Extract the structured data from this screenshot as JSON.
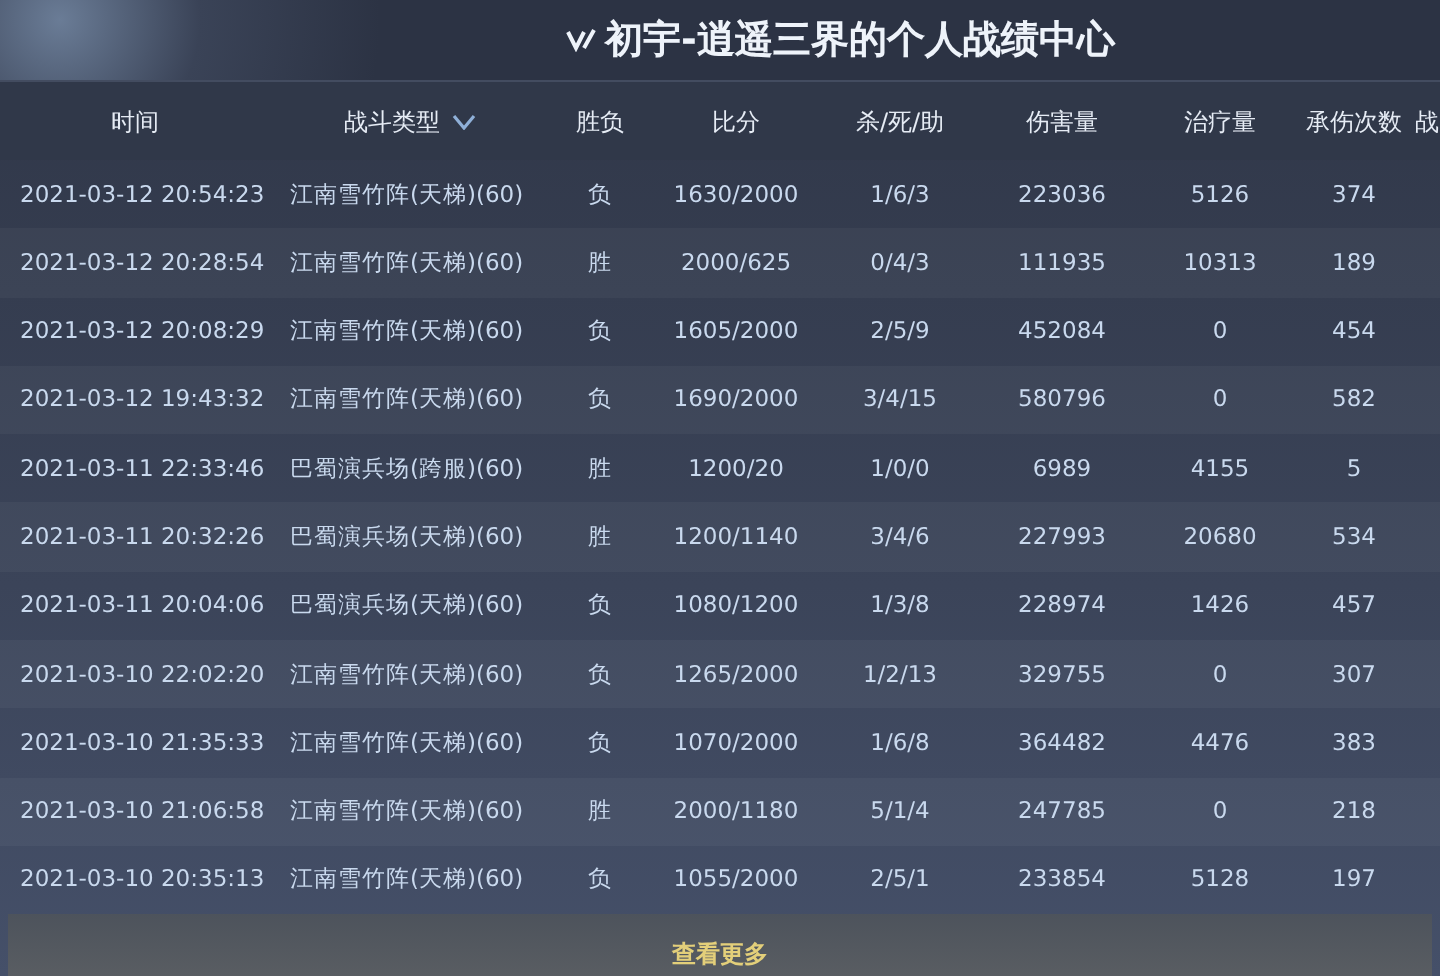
{
  "title": "初宇-逍遥三界的个人战绩中心",
  "table": {
    "columns": [
      {
        "label": "时间"
      },
      {
        "label": "战斗类型",
        "has_filter": true
      },
      {
        "label": "胜负"
      },
      {
        "label": "比分"
      },
      {
        "label": "杀/死/助"
      },
      {
        "label": "伤害量"
      },
      {
        "label": "治疗量"
      },
      {
        "label": "承伤次数"
      },
      {
        "label": "战"
      }
    ],
    "rows": [
      {
        "time": "2021-03-12 20:54:23",
        "type": "江南雪竹阵(天梯)(60)",
        "result": "负",
        "score": "1630/2000",
        "kda": "1/6/3",
        "damage": "223036",
        "healing": "5126",
        "hits_taken": "374"
      },
      {
        "time": "2021-03-12 20:28:54",
        "type": "江南雪竹阵(天梯)(60)",
        "result": "胜",
        "score": "2000/625",
        "kda": "0/4/3",
        "damage": "111935",
        "healing": "10313",
        "hits_taken": "189"
      },
      {
        "time": "2021-03-12 20:08:29",
        "type": "江南雪竹阵(天梯)(60)",
        "result": "负",
        "score": "1605/2000",
        "kda": "2/5/9",
        "damage": "452084",
        "healing": "0",
        "hits_taken": "454"
      },
      {
        "time": "2021-03-12 19:43:32",
        "type": "江南雪竹阵(天梯)(60)",
        "result": "负",
        "score": "1690/2000",
        "kda": "3/4/15",
        "damage": "580796",
        "healing": "0",
        "hits_taken": "582"
      },
      {
        "time": "2021-03-11 22:33:46",
        "type": "巴蜀演兵场(跨服)(60)",
        "result": "胜",
        "score": "1200/20",
        "kda": "1/0/0",
        "damage": "6989",
        "healing": "4155",
        "hits_taken": "5"
      },
      {
        "time": "2021-03-11 20:32:26",
        "type": "巴蜀演兵场(天梯)(60)",
        "result": "胜",
        "score": "1200/1140",
        "kda": "3/4/6",
        "damage": "227993",
        "healing": "20680",
        "hits_taken": "534"
      },
      {
        "time": "2021-03-11 20:04:06",
        "type": "巴蜀演兵场(天梯)(60)",
        "result": "负",
        "score": "1080/1200",
        "kda": "1/3/8",
        "damage": "228974",
        "healing": "1426",
        "hits_taken": "457"
      },
      {
        "time": "2021-03-10 22:02:20",
        "type": "江南雪竹阵(天梯)(60)",
        "result": "负",
        "score": "1265/2000",
        "kda": "1/2/13",
        "damage": "329755",
        "healing": "0",
        "hits_taken": "307"
      },
      {
        "time": "2021-03-10 21:35:33",
        "type": "江南雪竹阵(天梯)(60)",
        "result": "负",
        "score": "1070/2000",
        "kda": "1/6/8",
        "damage": "364482",
        "healing": "4476",
        "hits_taken": "383"
      },
      {
        "time": "2021-03-10 21:06:58",
        "type": "江南雪竹阵(天梯)(60)",
        "result": "胜",
        "score": "2000/1180",
        "kda": "5/1/4",
        "damage": "247785",
        "healing": "0",
        "hits_taken": "218"
      },
      {
        "time": "2021-03-10 20:35:13",
        "type": "江南雪竹阵(天梯)(60)",
        "result": "负",
        "score": "1055/2000",
        "kda": "2/5/1",
        "damage": "233854",
        "healing": "5128",
        "hits_taken": "197"
      }
    ]
  },
  "more_button": "查看更多"
}
